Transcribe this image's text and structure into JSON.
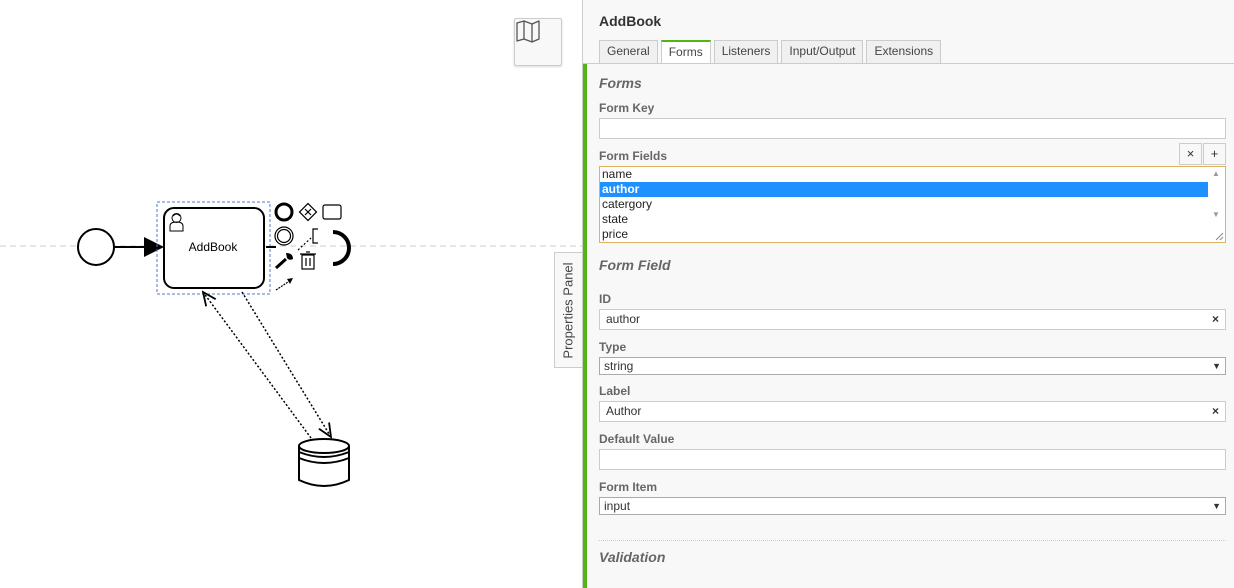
{
  "canvas": {
    "task_label": "AddBook",
    "properties_toggle_label": "Properties Panel",
    "minimap_icon": "map-icon",
    "context_pad_icons": [
      "end-event-icon",
      "gateway-icon",
      "task-icon",
      "intermediate-event-icon",
      "text-annotation-icon",
      "wrench-icon",
      "trash-icon",
      "connect-arrow-icon"
    ]
  },
  "panel": {
    "title": "AddBook",
    "tabs": [
      {
        "label": "General"
      },
      {
        "label": "Forms"
      },
      {
        "label": "Listeners"
      },
      {
        "label": "Input/Output"
      },
      {
        "label": "Extensions"
      }
    ],
    "active_tab": "Forms",
    "forms_section_title": "Forms",
    "form_key_label": "Form Key",
    "form_key_value": "",
    "form_fields_label": "Form Fields",
    "remove_button": "×",
    "add_button": "+",
    "form_fields": [
      "name",
      "author",
      "catergory",
      "state",
      "price"
    ],
    "selected_form_field": "author",
    "form_field_section_title": "Form Field",
    "id_label": "ID",
    "id_value": "author",
    "clear_symbol": "×",
    "type_label": "Type",
    "type_value": "string",
    "field_label_label": "Label",
    "field_label_value": "Author",
    "default_value_label": "Default Value",
    "default_value_value": "",
    "form_item_label": "Form Item",
    "form_item_value": "input",
    "validation_section_title": "Validation",
    "accent_color": "#52b415",
    "selection_color": "#1e90ff"
  }
}
